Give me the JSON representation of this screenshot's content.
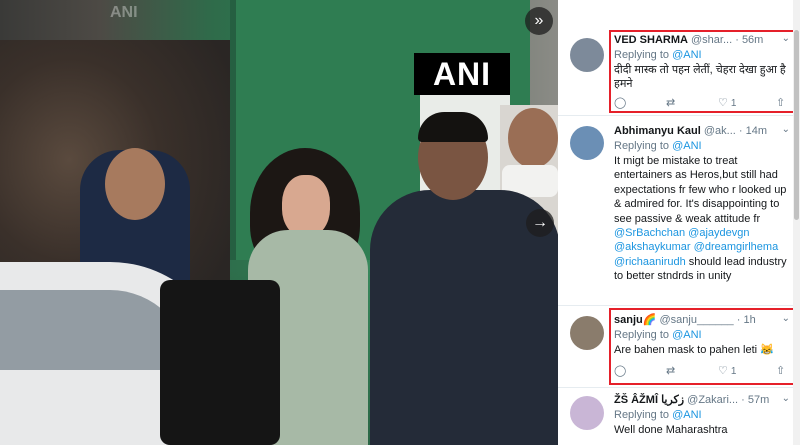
{
  "media": {
    "watermark": "ANI",
    "faint_watermark": "ANI",
    "next_icon": "»",
    "arrow_icon": "→"
  },
  "tweets": [
    {
      "name": "VED SHARMA",
      "handle": "@shar...",
      "time": "· 56m",
      "replying_prefix": "Replying to ",
      "replying_to": "@ANI",
      "text": "दीदी मास्क तो पहन लेतीं, चेहरा देखा हुआ है हमने",
      "likes": "1",
      "avatar_color": "#7d8a9a"
    },
    {
      "name": "Abhimanyu Kaul",
      "handle": "@ak...",
      "time": "· 14m",
      "replying_prefix": "Replying to ",
      "replying_to": "@ANI",
      "text_plain": "It migt be mistake to treat entertainers as Heros,but still had expectations fr few who r looked up & admired for. It's disappointing to see passive & weak attitude fr ",
      "text_links": [
        "@SrBachchan",
        "@ajaydevgn",
        "@akshaykumar",
        "@dreamgirlhema",
        "@richaanirudh"
      ],
      "text_tail": "should lead industry to better stndrds in unity",
      "avatar_color": "#6b8fb5"
    },
    {
      "name": "sanju🌈",
      "handle": "@sanju______",
      "time": "· 1h",
      "replying_prefix": "Replying to ",
      "replying_to": "@ANI",
      "text": "Are bahen mask to pahen leti 😹",
      "likes": "1",
      "avatar_color": "#8a7c6c"
    },
    {
      "name": "ŽŠ ÂŽMÎ زكريا",
      "handle": "@Zakari...",
      "time": "· 57m",
      "replying_prefix": "Replying to ",
      "replying_to": "@ANI",
      "text": "Well done Maharashtra",
      "avatar_color": "#c9b6d6"
    }
  ],
  "icons": {
    "reply": "◯",
    "retweet": "⇄",
    "like": "♡",
    "share": "⇧",
    "chevron": "⌄"
  },
  "colors": {
    "highlight_box": "#e5202a",
    "link": "#1b95e0"
  }
}
